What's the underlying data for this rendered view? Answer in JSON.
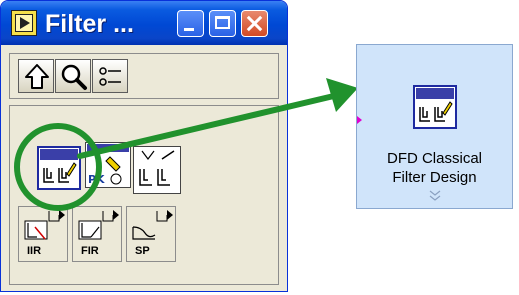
{
  "window": {
    "title": "Filter ...",
    "titlebar_buttons": [
      "minimize",
      "maximize",
      "close"
    ]
  },
  "toolbar": {
    "buttons": [
      {
        "name": "up",
        "icon": "up-arrow-icon"
      },
      {
        "name": "search",
        "icon": "magnifier-icon"
      },
      {
        "name": "options",
        "icon": "options-list-icon"
      }
    ]
  },
  "palette": {
    "icons": [
      {
        "name": "dfd-classical-filter-design",
        "icon": "filter-design-icon",
        "selected": true
      },
      {
        "name": "pole-zero-designer",
        "icon": "zpk-design-icon",
        "badge": "ZPK",
        "selected": false
      },
      {
        "name": "filter-analysis",
        "icon": "filter-analysis-icon",
        "selected": false
      }
    ],
    "subpalettes": [
      {
        "label": "IIR",
        "icon": "iir-subpalette-icon"
      },
      {
        "label": "FIR",
        "icon": "fir-subpalette-icon"
      },
      {
        "label": "SP",
        "icon": "sp-subpalette-icon"
      }
    ]
  },
  "node": {
    "title_line1": "DFD Classical",
    "title_line2": "Filter Design"
  },
  "colors": {
    "highlight": "#21922d",
    "titlebar": "#0a5be0",
    "node_bg": "#d0e4fa",
    "icon_border": "#1e2aa0"
  }
}
